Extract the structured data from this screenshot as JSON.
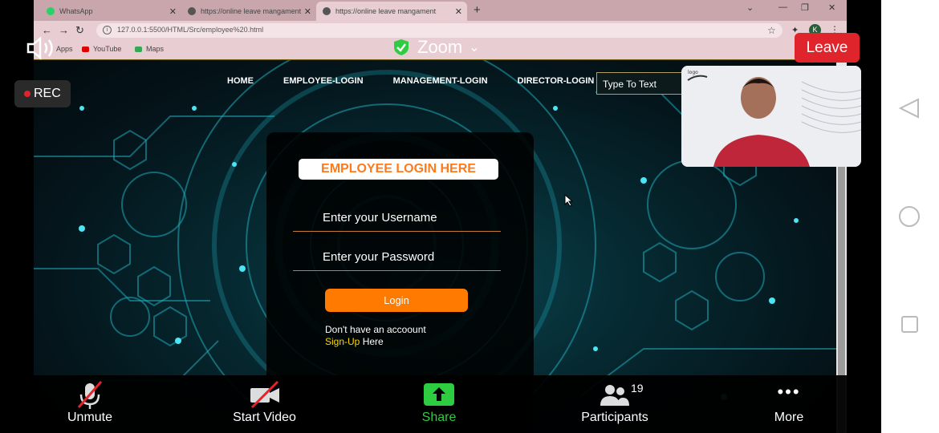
{
  "browser": {
    "tabs": [
      {
        "title": "WhatsApp",
        "color": "#25d366"
      },
      {
        "title": "https://online leave mangament",
        "color": "#555555"
      },
      {
        "title": "https://online leave mangament",
        "color": "#555555"
      }
    ],
    "url": "127.0.0.1:5500/HTML/Src/employee%20.html",
    "bookmarks": [
      {
        "label": "Apps",
        "color": "#4a6fd0"
      },
      {
        "label": "YouTube",
        "color": "#e00000"
      },
      {
        "label": "Maps",
        "color": "#34a853"
      }
    ],
    "new_tab": "+"
  },
  "site": {
    "nav": [
      "HOME",
      "EMPLOYEE-LOGIN",
      "MANAGEMENT-LOGIN",
      "DIRECTOR-LOGIN"
    ],
    "search_placeholder": "Type To Text",
    "login": {
      "title": "EMPLOYEE LOGIN HERE",
      "username_placeholder": "Enter your Username",
      "password_placeholder": "Enter your Password",
      "button": "Login",
      "no_account": "Don't have an accoount",
      "signup_link": "Sign-Up",
      "signup_suffix": " Here"
    }
  },
  "zoom": {
    "title": "Zoom",
    "leave": "Leave",
    "rec": "REC",
    "toolbar": {
      "unmute": "Unmute",
      "start_video": "Start Video",
      "share": "Share",
      "participants": "Participants",
      "participants_count": "19",
      "more": "More"
    },
    "colors": {
      "leave": "#e0242b",
      "share": "#2ecc40",
      "shield": "#2ecc40"
    }
  }
}
